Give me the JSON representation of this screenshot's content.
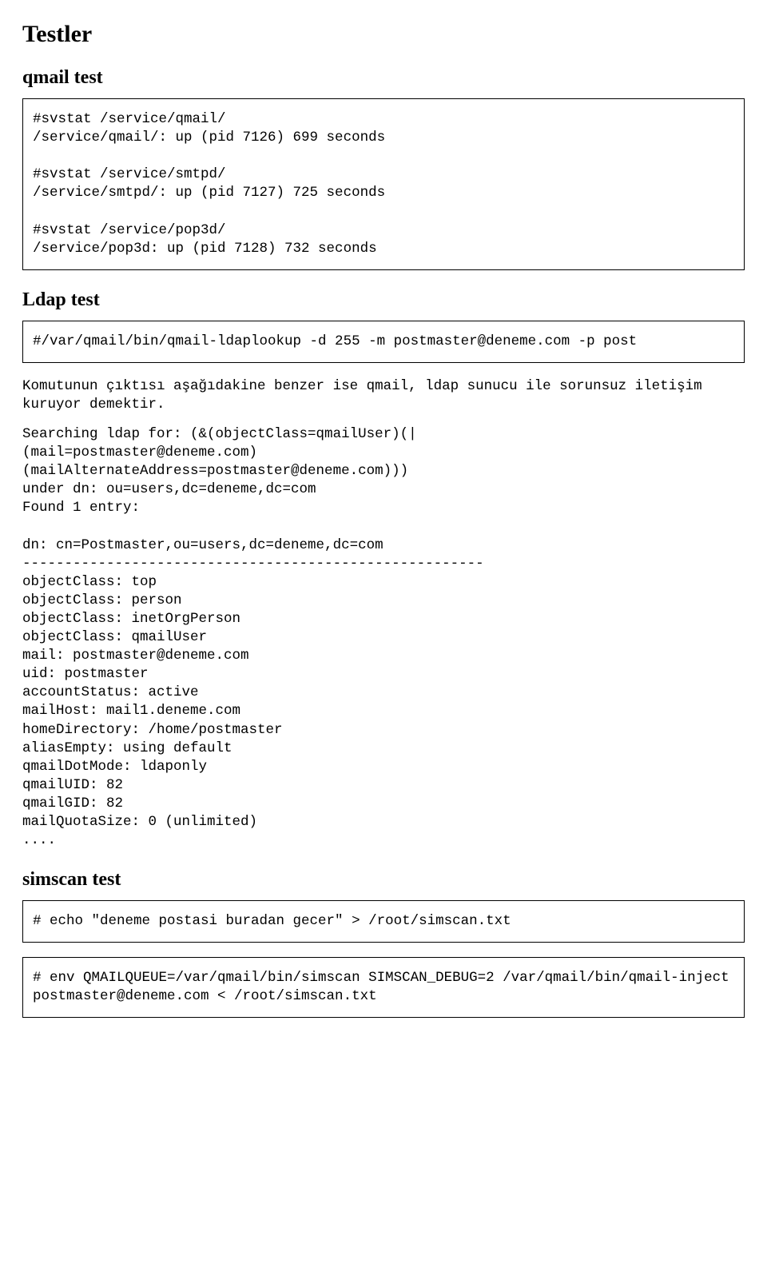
{
  "title": "Testler",
  "sections": {
    "qmail_test": {
      "heading": "qmail test",
      "box": "#svstat /service/qmail/\n/service/qmail/: up (pid 7126) 699 seconds\n\n#svstat /service/smtpd/\n/service/smtpd/: up (pid 7127) 725 seconds\n\n#svstat /service/pop3d/\n/service/pop3d: up (pid 7128) 732 seconds"
    },
    "ldap_test": {
      "heading": "Ldap test",
      "box": "#/var/qmail/bin/qmail-ldaplookup -d 255 -m postmaster@deneme.com -p post",
      "note": "Komutunun çıktısı aşağıdakine benzer ise qmail, ldap sunucu ile sorunsuz iletişim kuruyor demektir.",
      "output": "Searching ldap for: (&(objectClass=qmailUser)(|\n(mail=postmaster@deneme.com)\n(mailAlternateAddress=postmaster@deneme.com)))\nunder dn: ou=users,dc=deneme,dc=com\nFound 1 entry:\n\ndn: cn=Postmaster,ou=users,dc=deneme,dc=com\n-------------------------------------------------------\nobjectClass: top\nobjectClass: person\nobjectClass: inetOrgPerson\nobjectClass: qmailUser\nmail: postmaster@deneme.com\nuid: postmaster\naccountStatus: active\nmailHost: mail1.deneme.com\nhomeDirectory: /home/postmaster\naliasEmpty: using default\nqmailDotMode: ldaponly\nqmailUID: 82\nqmailGID: 82\nmailQuotaSize: 0 (unlimited)\n...."
    },
    "simscan_test": {
      "heading": "simscan test",
      "box1": "# echo \"deneme postasi buradan gecer\" > /root/simscan.txt",
      "box2": "# env QMAILQUEUE=/var/qmail/bin/simscan SIMSCAN_DEBUG=2 /var/qmail/bin/qmail-inject postmaster@deneme.com < /root/simscan.txt"
    }
  }
}
